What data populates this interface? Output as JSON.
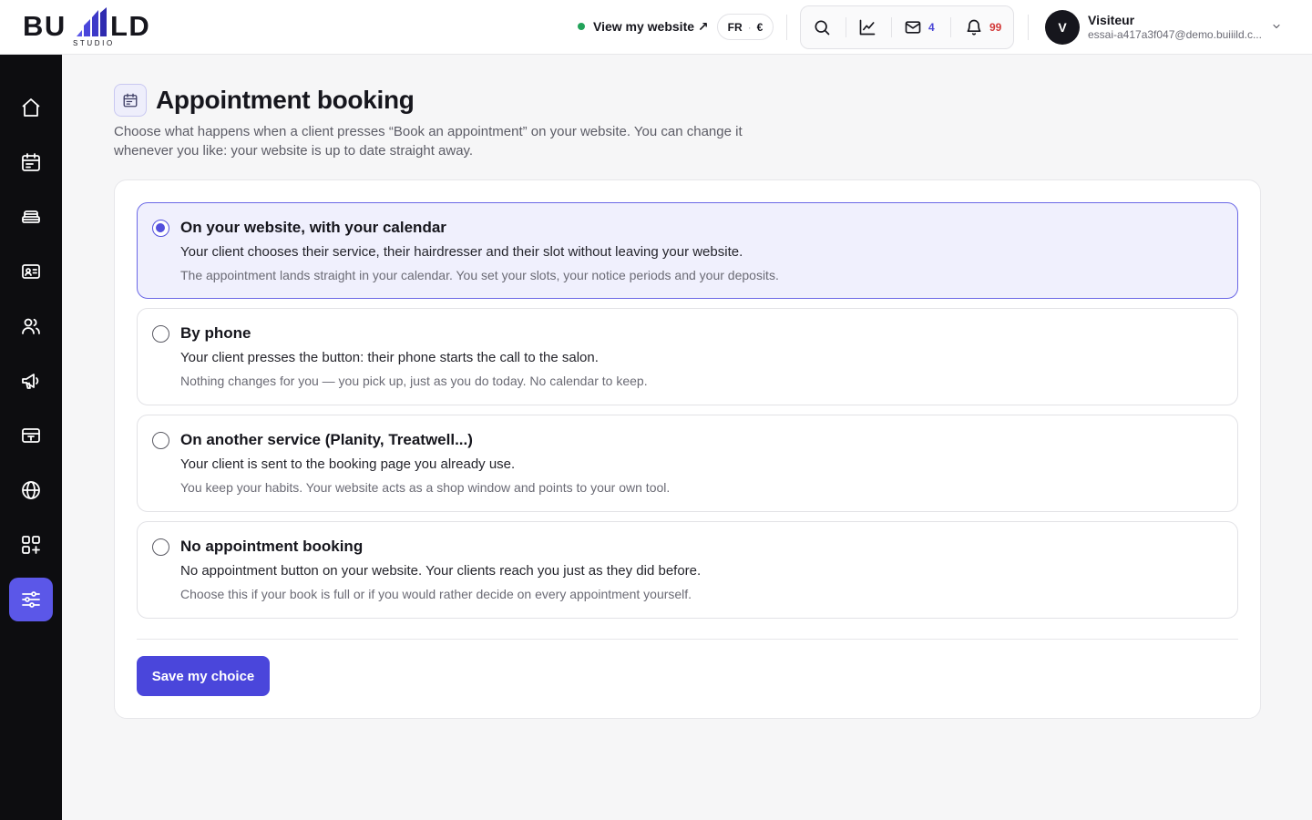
{
  "brand": {
    "wordmark_left": "BU",
    "wordmark_right": "LD",
    "tagline": "STUDIO",
    "accent": "#5b57e8"
  },
  "header": {
    "view_site_label": "View my website ↗",
    "lang": "FR",
    "currency": "€",
    "tools": {
      "search_icon": "search-icon",
      "stats_icon": "chart-line-icon",
      "mail_icon": "mail-icon",
      "mail_count": "4",
      "bell_icon": "bell-icon",
      "notification_count": "99"
    },
    "user": {
      "initial": "V",
      "name": "Visiteur",
      "email": "essai-a417a3f047@demo.buiiild.c..."
    }
  },
  "sidebar": {
    "items": [
      {
        "icon": "home-icon"
      },
      {
        "icon": "calendar-icon"
      },
      {
        "icon": "services-icon"
      },
      {
        "icon": "contact-card-icon"
      },
      {
        "icon": "users-icon"
      },
      {
        "icon": "megaphone-icon"
      },
      {
        "icon": "payment-card-icon"
      },
      {
        "icon": "globe-icon"
      },
      {
        "icon": "apps-add-icon"
      },
      {
        "icon": "sliders-icon",
        "active": true
      }
    ]
  },
  "page": {
    "icon": "calendar-icon",
    "title": "Appointment booking",
    "description": "Choose what happens when a client presses “Book an appointment” on your website. You can change it whenever you like: your website is up to date straight away."
  },
  "options": [
    {
      "title": "On your website, with your calendar",
      "line1": "Your client chooses their service, their hairdresser and their slot without leaving your website.",
      "line2": "The appointment lands straight in your calendar. You set your slots, your notice periods and your deposits.",
      "selected": true
    },
    {
      "title": "By phone",
      "line1": "Your client presses the button: their phone starts the call to the salon.",
      "line2": "Nothing changes for you — you pick up, just as you do today. No calendar to keep.",
      "selected": false
    },
    {
      "title": "On another service (Planity, Treatwell...)",
      "line1": "Your client is sent to the booking page you already use.",
      "line2": "You keep your habits. Your website acts as a shop window and points to your own tool.",
      "selected": false
    },
    {
      "title": "No appointment booking",
      "line1": "No appointment button on your website. Your clients reach you just as they did before.",
      "line2": "Choose this if your book is full or if you would rather decide on every appointment yourself.",
      "selected": false
    }
  ],
  "actions": {
    "save_label": "Save my choice"
  }
}
